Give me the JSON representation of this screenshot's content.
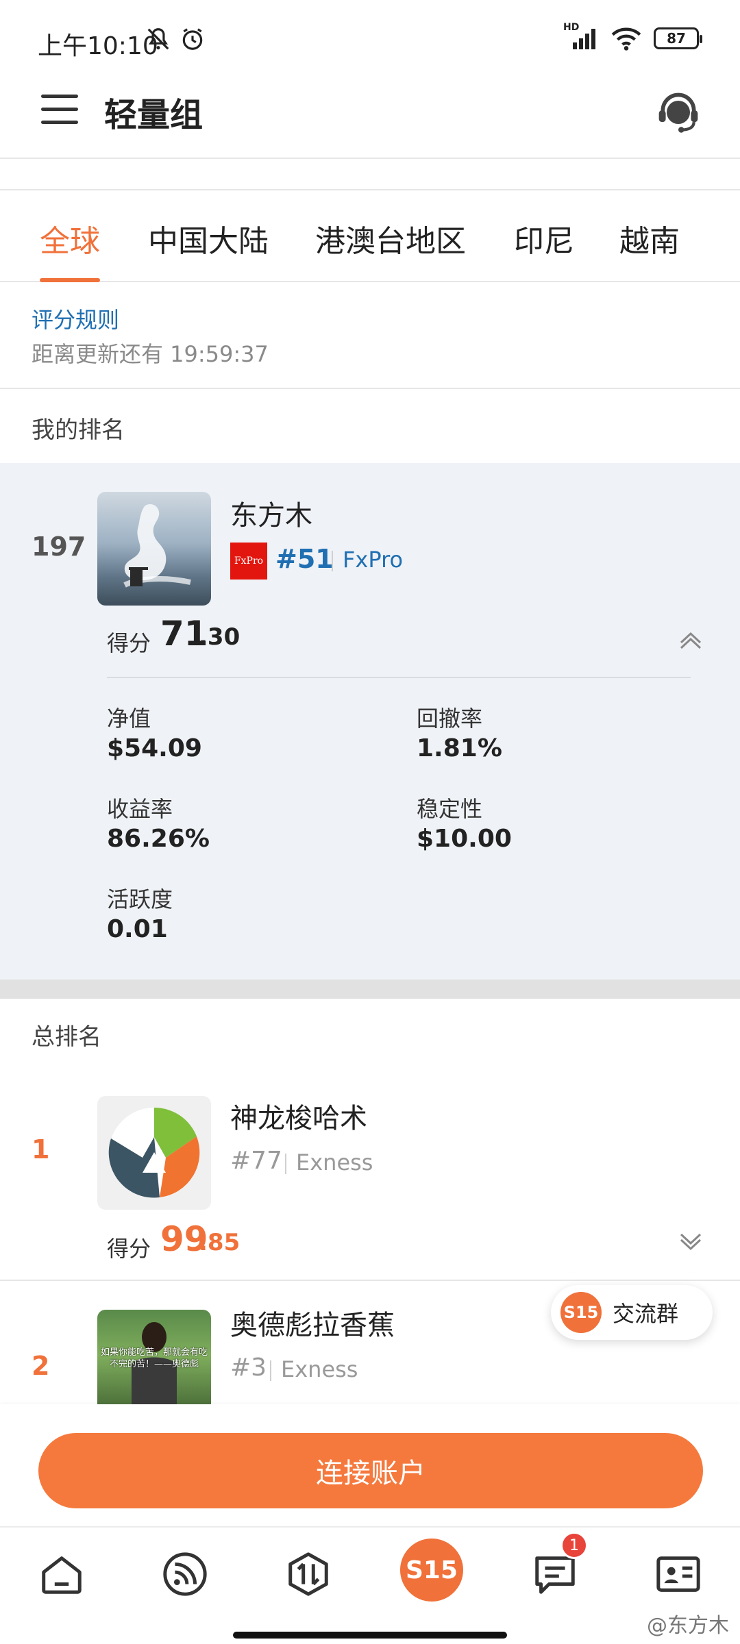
{
  "status_bar": {
    "time": "上午10:10",
    "network_label": "HD",
    "battery": "87"
  },
  "header": {
    "title": "轻量组"
  },
  "tabs": [
    {
      "label": "全球",
      "active": true
    },
    {
      "label": "中国大陆",
      "active": false
    },
    {
      "label": "港澳台地区",
      "active": false
    },
    {
      "label": "印尼",
      "active": false
    },
    {
      "label": "越南",
      "active": false
    }
  ],
  "rules": {
    "link_label": "评分规则",
    "countdown": "距离更新还有 19:59:37"
  },
  "my_ranking": {
    "heading": "我的排名",
    "rank": "197",
    "name": "东方木",
    "broker_logo_text": "FxPro",
    "broker_rank": "#51",
    "broker": "FxPro",
    "score_label": "得分",
    "score_int": "71",
    "score_dec": ".30",
    "metrics": [
      {
        "label": "净值",
        "value": "$54.09"
      },
      {
        "label": "回撤率",
        "value": "1.81%"
      },
      {
        "label": "收益率",
        "value": "86.26%"
      },
      {
        "label": "稳定性",
        "value": "$10.00"
      },
      {
        "label": "活跃度",
        "value": "0.01"
      }
    ],
    "colors": {
      "rank": "#555555",
      "broker": "#1f6fb2"
    }
  },
  "total_ranking": {
    "heading": "总排名",
    "rows": [
      {
        "rank": "1",
        "name": "神龙梭哈术",
        "broker_rank": "#77",
        "broker": "Exness",
        "score_label": "得分",
        "score_int": "99",
        "score_dec": ".85"
      },
      {
        "rank": "2",
        "name": "奥德彪拉香蕉",
        "broker_rank": "#3",
        "broker": "Exness",
        "avatar_caption": "如果你能吃苦，那就会有吃不完的苦！——奥德彪"
      }
    ]
  },
  "community": {
    "badge": "S15",
    "label": "交流群"
  },
  "connect_button": "连接账户",
  "bottom_nav": {
    "items": [
      "home-icon",
      "feed-icon",
      "exchange-icon",
      "s15-logo",
      "message-icon",
      "profile-card-icon"
    ],
    "center_label": "S15",
    "message_badge": "1"
  },
  "watermark": "@东方木",
  "accent_color": "#f0713a"
}
